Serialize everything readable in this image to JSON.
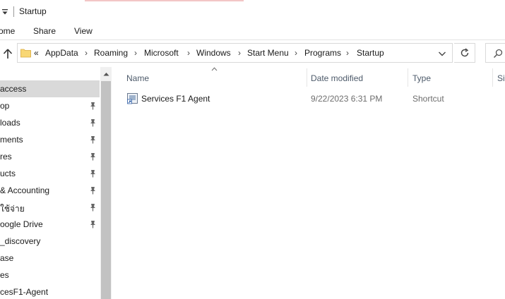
{
  "window": {
    "title": "Startup"
  },
  "ribbon": {
    "tabs": [
      "ome",
      "Share",
      "View"
    ]
  },
  "address": {
    "overflow": "«",
    "crumbs": [
      "AppData",
      "Roaming",
      "Microsoft",
      "Windows",
      "Start Menu",
      "Programs",
      "Startup"
    ],
    "separator": "›"
  },
  "nav": {
    "items": [
      {
        "label": "access",
        "pinned": false,
        "selected": true
      },
      {
        "label": "op",
        "pinned": true
      },
      {
        "label": "loads",
        "pinned": true
      },
      {
        "label": "ments",
        "pinned": true
      },
      {
        "label": "res",
        "pinned": true
      },
      {
        "label": "ucts",
        "pinned": true
      },
      {
        "label": "& Accounting",
        "pinned": true
      },
      {
        "label": "ใช้จ่าย",
        "pinned": true
      },
      {
        "label": "oogle Drive",
        "pinned": true
      },
      {
        "label": "_discovery",
        "pinned": false
      },
      {
        "label": "ase",
        "pinned": false
      },
      {
        "label": "es",
        "pinned": false
      },
      {
        "label": "cesF1-Agent",
        "pinned": false
      }
    ]
  },
  "columns": {
    "name": "Name",
    "date": "Date modified",
    "type": "Type",
    "size": "Siz"
  },
  "files": [
    {
      "name": "Services F1 Agent",
      "date": "9/22/2023 6:31 PM",
      "type": "Shortcut"
    }
  ],
  "icons": {
    "up": "up-arrow-icon",
    "folder": "folder-icon",
    "refresh": "refresh-icon",
    "search": "search-icon",
    "pin": "pin-icon",
    "shortcut": "shortcut-file-icon"
  },
  "colors": {
    "selected": "#d9d9d9",
    "header_text": "#4d5a6a",
    "folder": "#f8d775"
  }
}
